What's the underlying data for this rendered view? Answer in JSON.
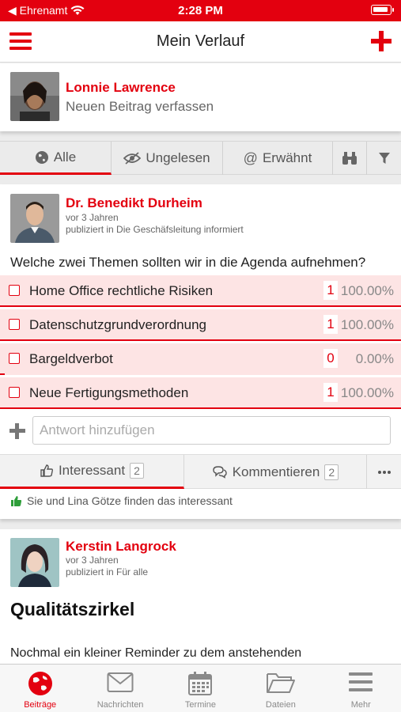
{
  "status_bar": {
    "carrier": "◀ Ehrenamt",
    "time": "2:28 PM"
  },
  "header": {
    "title": "Mein Verlauf",
    "menu_icon": "hamburger-icon",
    "add_icon": "plus-icon"
  },
  "composer": {
    "user_name": "Lonnie Lawrence",
    "prompt": "Neuen Beitrag verfassen"
  },
  "filters": {
    "tabs": [
      {
        "label": "Alle",
        "icon": "globe-icon",
        "active": true
      },
      {
        "label": "Ungelesen",
        "icon": "eye-slash-icon",
        "active": false
      },
      {
        "label": "Erwähnt",
        "icon": "at-icon",
        "active": false
      }
    ],
    "search_icon": "binoculars-icon",
    "filter_icon": "funnel-icon"
  },
  "post1": {
    "author": "Dr. Benedikt Durheim",
    "time": "vor 3 Jahren",
    "published": "publiziert in Die Geschäfsleitung informiert",
    "question": "Welche zwei Themen sollten wir in die Agenda aufnehmen?",
    "options": [
      {
        "label": "Home Office rechtliche Risiken",
        "count": "1",
        "percent": "100.00%",
        "fraction": 1.0
      },
      {
        "label": "Datenschutzgrundverordnung",
        "count": "1",
        "percent": "100.00%",
        "fraction": 1.0
      },
      {
        "label": "Bargeldverbot",
        "count": "0",
        "percent": "0.00%",
        "fraction": 0.0
      },
      {
        "label": "Neue Fertigungsmethoden",
        "count": "1",
        "percent": "100.00%",
        "fraction": 1.0
      }
    ],
    "answer_placeholder": "Antwort hinzufügen",
    "actions": {
      "like_label": "Interessant",
      "like_count": "2",
      "comment_label": "Kommentieren",
      "comment_count": "2",
      "more_icon": "ellipsis-icon"
    },
    "likes_text": "Sie und Lina Götze finden das interessant"
  },
  "post2": {
    "author": "Kerstin Langrock",
    "time": "vor 3 Jahren",
    "published": "publiziert in Für alle",
    "title": "Qualitätszirkel",
    "body": "Nochmal ein kleiner Reminder zu dem anstehenden"
  },
  "tabbar": {
    "items": [
      {
        "label": "Beiträge",
        "icon": "globe-icon",
        "active": true
      },
      {
        "label": "Nachrichten",
        "icon": "envelope-icon",
        "active": false
      },
      {
        "label": "Termine",
        "icon": "calendar-icon",
        "active": false
      },
      {
        "label": "Dateien",
        "icon": "folder-icon",
        "active": false
      },
      {
        "label": "Mehr",
        "icon": "menu-icon",
        "active": false
      }
    ]
  },
  "colors": {
    "accent": "#e3000f",
    "option_bg": "#fde4e4"
  }
}
